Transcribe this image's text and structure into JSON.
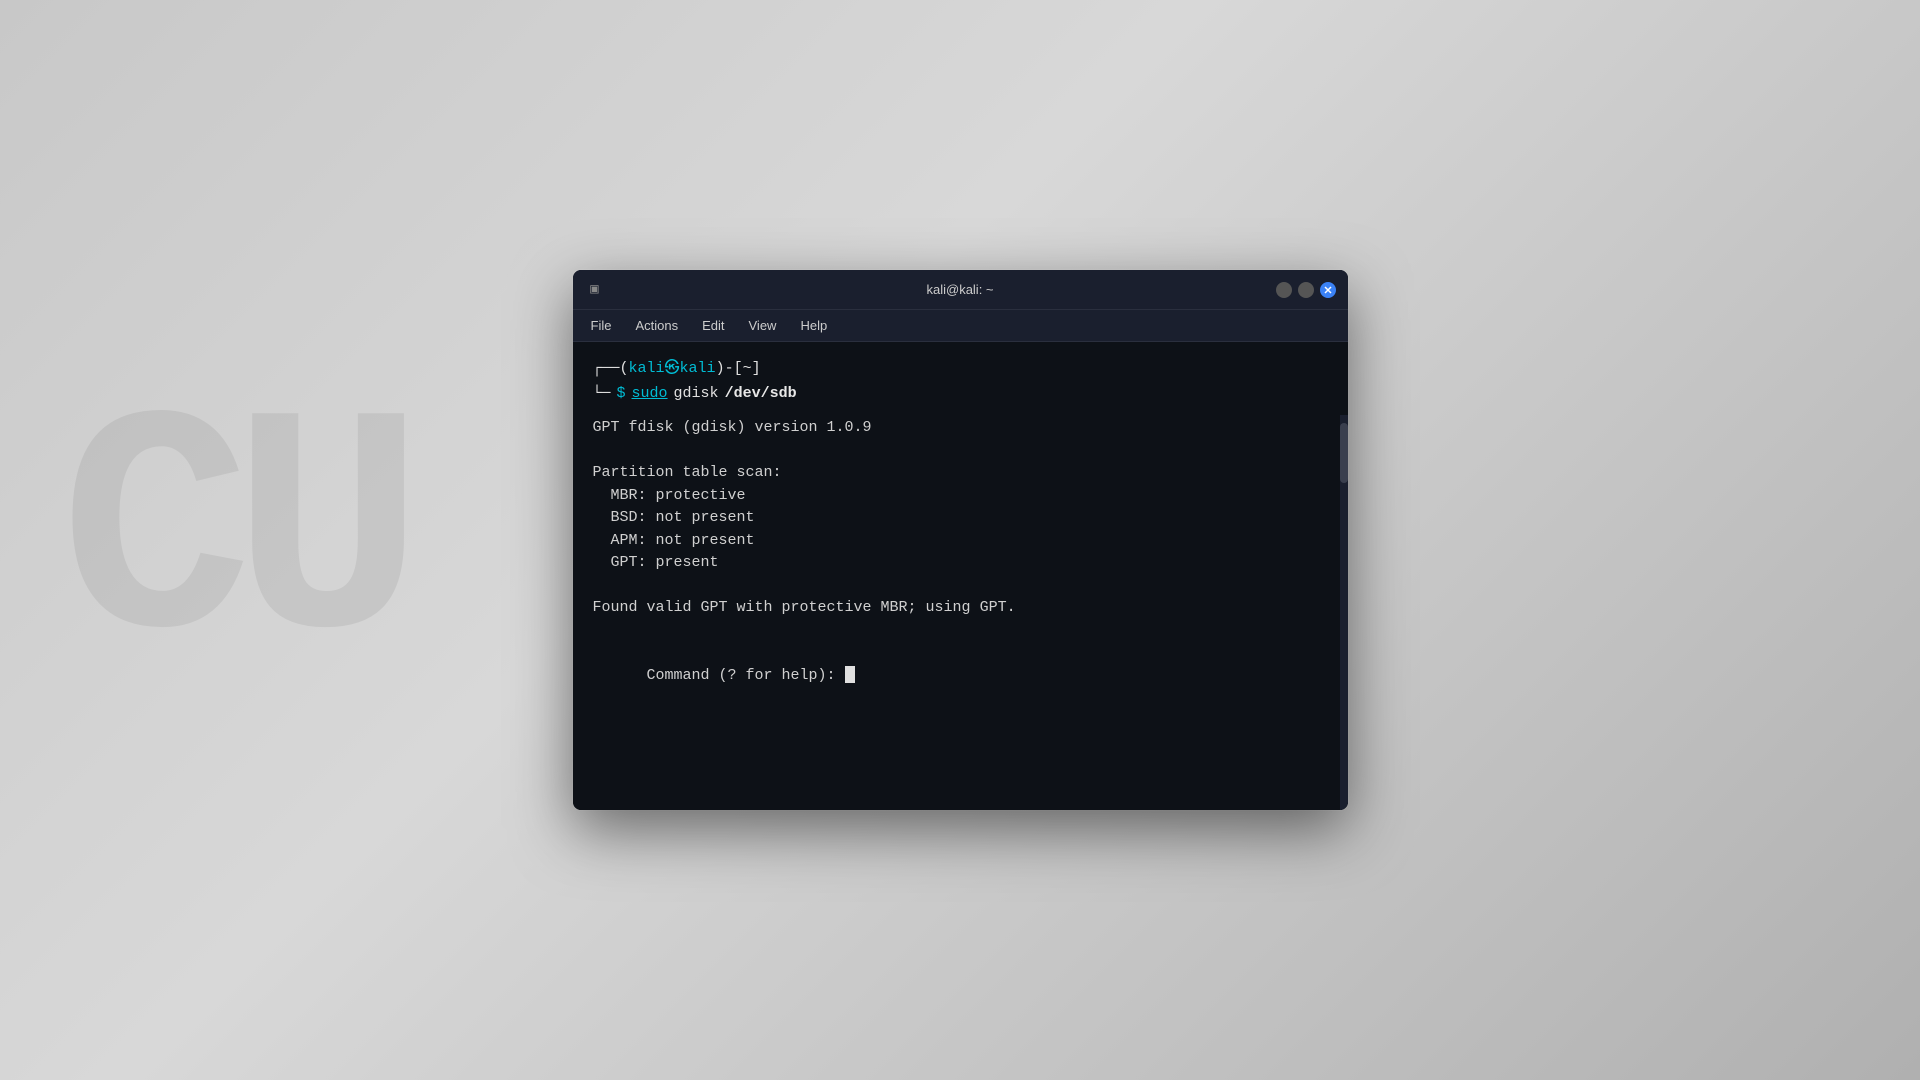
{
  "background": {
    "watermark": "CU"
  },
  "window": {
    "title": "kali@kali: ~",
    "controls": {
      "minimize_label": "",
      "maximize_label": "",
      "close_label": "✕"
    }
  },
  "menu": {
    "items": [
      "File",
      "Actions",
      "Edit",
      "View",
      "Help"
    ]
  },
  "terminal": {
    "prompt": {
      "user": "kali",
      "at": "@",
      "host": "kali",
      "dir": "~"
    },
    "command": {
      "sudo": "sudo",
      "gdisk": "gdisk",
      "path": "/dev/sdb"
    },
    "output": [
      "GPT fdisk (gdisk) version 1.0.9",
      "",
      "Partition table scan:",
      "  MBR: protective",
      "  BSD: not present",
      "  APM: not present",
      "  GPT: present",
      "",
      "Found valid GPT with protective MBR; using GPT.",
      "",
      "Command (? for help): "
    ]
  }
}
